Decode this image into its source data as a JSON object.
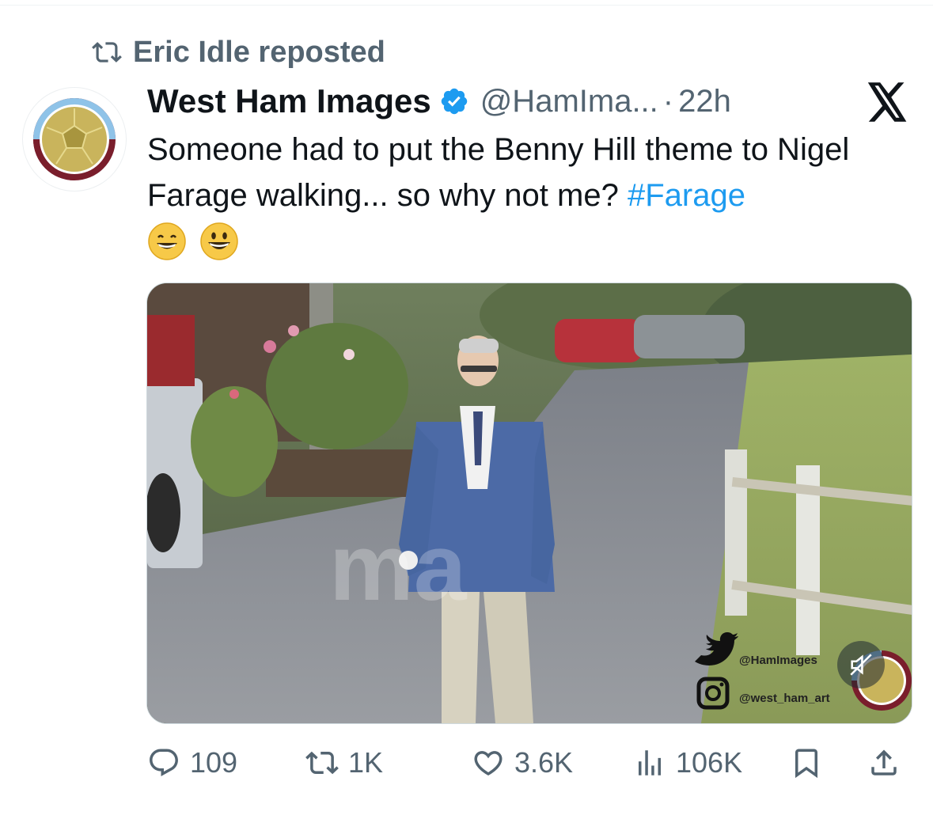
{
  "repost": {
    "label": "Eric Idle reposted",
    "icon": "repost-icon"
  },
  "author": {
    "name": "West Ham Images",
    "handle": "@HamIma...",
    "separator": "·",
    "time": "22h",
    "verified": true
  },
  "platform_logo": "x-logo",
  "tweet": {
    "text": "Someone had to put the Benny Hill theme to Nigel Farage walking... so why not me? ",
    "hashtag": "#Farage",
    "emojis": [
      "grinning-face-with-smiling-eyes-emoji",
      "grinning-face-emoji"
    ]
  },
  "media": {
    "type": "video",
    "muted": true,
    "watermark_twitter": "@HamImages",
    "watermark_instagram": "@west_ham_art",
    "watermark_text": "ma"
  },
  "actions": {
    "replies": "109",
    "reposts": "1K",
    "likes": "3.6K",
    "views": "106K"
  },
  "colors": {
    "link": "#1d9bf0",
    "secondary_text": "#536471",
    "primary_text": "#0f1419",
    "verified": "#1d9bf0"
  }
}
